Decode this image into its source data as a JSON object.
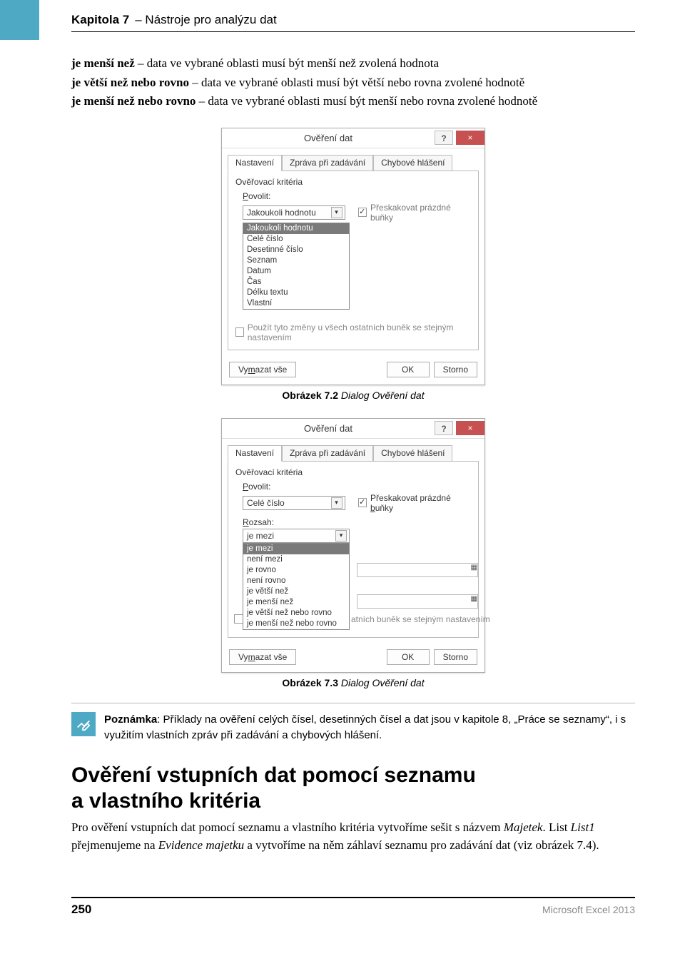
{
  "header": {
    "chapter": "Kapitola 7",
    "title": "– Nástroje pro analýzu dat"
  },
  "defs": {
    "d1_b": "je menší než",
    "d1": " – data ve vybrané oblasti musí být menší než zvolená hodnota",
    "d2_b": "je větší než nebo rovno",
    "d2": " – data ve vybrané oblasti musí být větší nebo rovna zvolené hodnotě",
    "d3_b": "je menší než nebo rovno",
    "d3": " – data ve vybrané oblasti musí být menší nebo rovna zvolené hodnotě"
  },
  "dialog1": {
    "title": "Ověření dat",
    "tabs": {
      "t1": "Nastavení",
      "t2": "Zpráva při zadávání",
      "t3": "Chybové hlášení"
    },
    "group": "Ověřovací kritéria",
    "allow_label": "Povolit:",
    "allow_value": "Jakoukoli hodnotu",
    "skip_label": "Přeskakovat prázdné buňky",
    "options": {
      "o0": "Jakoukoli hodnotu",
      "o1": "Celé číslo",
      "o2": "Desetinné číslo",
      "o3": "Seznam",
      "o4": "Datum",
      "o5": "Čas",
      "o6": "Délku textu",
      "o7": "Vlastní"
    },
    "apply": "Použít tyto změny u všech ostatních buněk se stejným nastavením",
    "clear": "Vymazat vše",
    "ok": "OK",
    "cancel": "Storno"
  },
  "cap1_b": "Obrázek 7.2",
  "cap1_i": " Dialog Ověření dat",
  "dialog2": {
    "title": "Ověření dat",
    "tabs": {
      "t1": "Nastavení",
      "t2": "Zpráva při zadávání",
      "t3": "Chybové hlášení"
    },
    "group": "Ověřovací kritéria",
    "allow_label": "Povolit:",
    "allow_value": "Celé číslo",
    "skip_label": "Přeskakovat prázdné buňky",
    "range_label": "Rozsah:",
    "range_value": "je mezi",
    "options": {
      "o0": "je mezi",
      "o1": "není mezi",
      "o2": "je rovno",
      "o3": "není rovno",
      "o4": "je větší než",
      "o5": "je menší než",
      "o6": "je větší než nebo rovno",
      "o7": "je menší než nebo rovno"
    },
    "behind_text": "atních buněk se stejným nastavením",
    "clear": "Vymazat vše",
    "ok": "OK",
    "cancel": "Storno"
  },
  "cap2_b": "Obrázek 7.3",
  "cap2_i": " Dialog Ověření dat",
  "note_b": "Poznámka",
  "note": ": Příklady na ověření celých čísel, desetinných čísel a dat jsou v kapitole 8, „Práce se seznamy“, i s využitím vlastních zpráv při zadávání a chybových hlášení.",
  "h2_l1": "Ověření vstupních dat pomocí seznamu",
  "h2_l2": "a vlastního kritéria",
  "para": {
    "p1a": "Pro ověření vstupních dat pomocí seznamu a vlastního kritéria vytvoříme sešit s názvem ",
    "p1b": "Majetek",
    "p1c": ". List ",
    "p1d": "List1",
    "p1e": " přejmenujeme na ",
    "p1f": "Evidence majetku",
    "p1g": " a vytvoříme na něm záhlaví seznamu pro zadávání dat (viz obrázek 7.4)."
  },
  "footer": {
    "page": "250",
    "src": "Microsoft Excel 2013"
  }
}
